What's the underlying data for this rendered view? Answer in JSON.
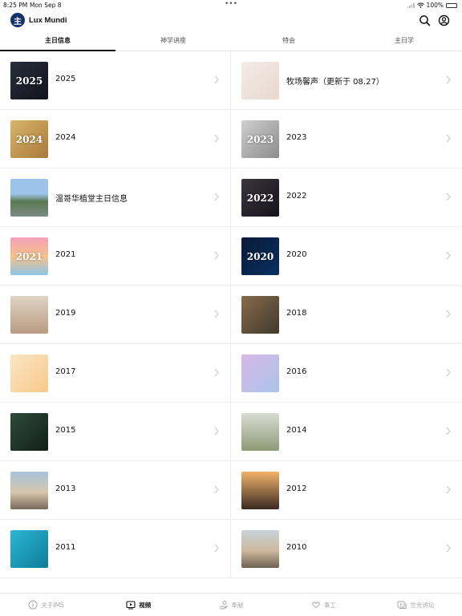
{
  "status_bar": {
    "time": "8:25 PM",
    "date": "Mon Sep 8",
    "battery": "100%"
  },
  "header": {
    "logo_glyph": "主",
    "title": "Lux Mundi"
  },
  "tabs": [
    {
      "label": "主日信息",
      "active": true
    },
    {
      "label": "神学讲座",
      "active": false
    },
    {
      "label": "特会",
      "active": false
    },
    {
      "label": "主日学",
      "active": false
    }
  ],
  "items": [
    {
      "label": "2025",
      "thumb_text": "2025",
      "bg": "linear-gradient(135deg,#2a2f3d,#11131a)"
    },
    {
      "label": "牧场馨声（更新于 08.27）",
      "thumb_text": "",
      "bg": "linear-gradient(135deg,#f4ece6,#e8d8cf)"
    },
    {
      "label": "2024",
      "thumb_text": "2024",
      "bg": "linear-gradient(135deg,#d9b56a,#a9793a)"
    },
    {
      "label": "2023",
      "thumb_text": "2023",
      "bg": "linear-gradient(135deg,#cfcfcf,#8c8c8c)"
    },
    {
      "label": "温哥华植堂主日信息",
      "thumb_text": "",
      "bg": "linear-gradient(180deg,#9cc4ea 0%,#9cc4ea 40%,#5a7a4e 60%,#7b8a86 100%)"
    },
    {
      "label": "2022",
      "thumb_text": "2022",
      "bg": "linear-gradient(135deg,#3a3540,#15131a)"
    },
    {
      "label": "2021",
      "thumb_text": "2021",
      "bg": "linear-gradient(180deg,#f4a0b8,#f6c28a,#8ec5e8)"
    },
    {
      "label": "2020",
      "thumb_text": "2020",
      "bg": "linear-gradient(135deg,#0b1a3a,#06305e)"
    },
    {
      "label": "2019",
      "thumb_text": "",
      "bg": "linear-gradient(180deg,#e0d4c4,#b89a80)"
    },
    {
      "label": "2018",
      "thumb_text": "",
      "bg": "linear-gradient(135deg,#8a6a4a,#3f3a2e)"
    },
    {
      "label": "2017",
      "thumb_text": "",
      "bg": "linear-gradient(135deg,#fbe5c5,#f7c98a)"
    },
    {
      "label": "2016",
      "thumb_text": "",
      "bg": "linear-gradient(135deg,#d7b8e6,#a9c4ea)"
    },
    {
      "label": "2015",
      "thumb_text": "",
      "bg": "linear-gradient(135deg,#2d4a3a,#122018)"
    },
    {
      "label": "2014",
      "thumb_text": "",
      "bg": "linear-gradient(180deg,#d9dcd2,#8d9a78)"
    },
    {
      "label": "2013",
      "thumb_text": "",
      "bg": "linear-gradient(180deg,#a8c4dc 0%,#d6c6ac 55%,#7a6a5a 100%)"
    },
    {
      "label": "2012",
      "thumb_text": "",
      "bg": "linear-gradient(180deg,#f3b26a,#3a2a22)"
    },
    {
      "label": "2011",
      "thumb_text": "",
      "bg": "linear-gradient(135deg,#2bb7d4,#0e7c98)"
    },
    {
      "label": "2010",
      "thumb_text": "",
      "bg": "linear-gradient(180deg,#c7d3dc 0%,#cdb89c 55%,#6e6050 100%)"
    }
  ],
  "bottom_tabs": [
    {
      "label": "关于IMS",
      "icon": "info-icon",
      "active": false
    },
    {
      "label": "视频",
      "icon": "video-icon",
      "active": true
    },
    {
      "label": "奉献",
      "icon": "giving-hand-icon",
      "active": false
    },
    {
      "label": "事工",
      "icon": "heart-hands-icon",
      "active": false
    },
    {
      "label": "世光讲坛",
      "icon": "media-library-icon",
      "active": false
    }
  ],
  "colors": {
    "accent": "#14316b",
    "active_text": "#111111",
    "inactive_text": "#aaaaaa"
  }
}
